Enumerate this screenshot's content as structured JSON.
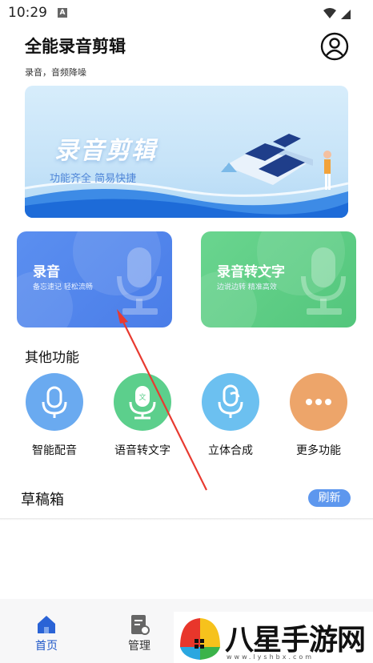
{
  "status_bar": {
    "time": "10:29",
    "notification_letter": "A"
  },
  "header": {
    "title": "全能录音剪辑",
    "subtitle": "录音，音频降噪"
  },
  "banner": {
    "title": "录音剪辑",
    "subtitle": "功能齐全 简易快捷"
  },
  "cards": {
    "record": {
      "title": "录音",
      "subtitle": "备忘速记 轻松流畅"
    },
    "speech_to_text": {
      "title": "录音转文字",
      "subtitle": "边说边转 精准高效"
    }
  },
  "other_functions": {
    "heading": "其他功能",
    "items": [
      {
        "label": "智能配音",
        "icon": "mic-icon",
        "color": "#6aaaf0"
      },
      {
        "label": "语音转文字",
        "icon": "mic-text-icon",
        "color": "#5ccf8c"
      },
      {
        "label": "立体合成",
        "icon": "mic-stereo-icon",
        "color": "#6cc0f0"
      },
      {
        "label": "更多功能",
        "icon": "more-icon",
        "color": "#eda56a"
      }
    ]
  },
  "drafts": {
    "title": "草稿箱",
    "refresh_label": "刷新"
  },
  "bottom_nav": {
    "home_label": "首页",
    "manage_label": "管理"
  },
  "watermark": {
    "text": "八星手游网",
    "url": "www.lyshbx.com"
  },
  "colors": {
    "accent_blue": "#4a7de8",
    "accent_green": "#53c67c",
    "nav_active": "#1e57c8",
    "annotation_red": "#e83a30"
  }
}
